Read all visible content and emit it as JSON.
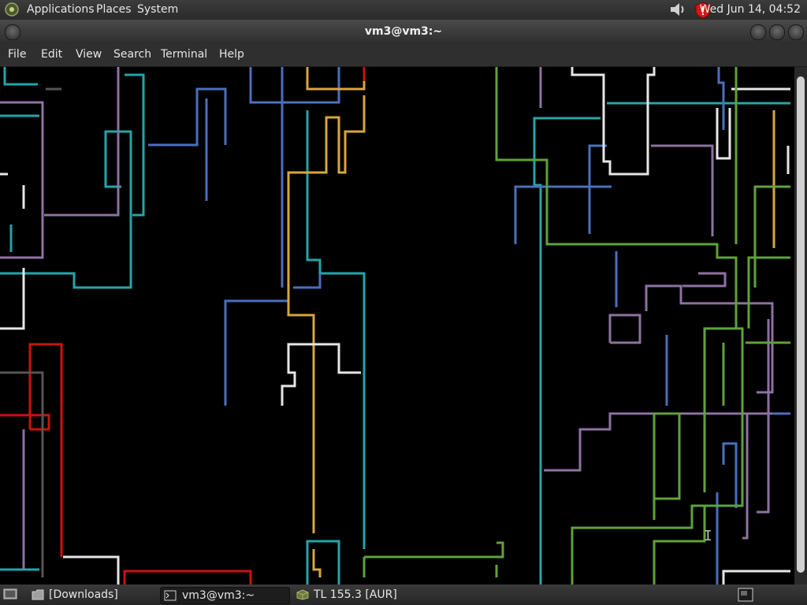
{
  "top_panel": {
    "menus": [
      "Applications",
      "Places",
      "System"
    ],
    "clock": "Wed Jun 14, 04:52"
  },
  "window": {
    "title": "vm3@vm3:~"
  },
  "menubar": [
    "File",
    "Edit",
    "View",
    "Search",
    "Terminal",
    "Help"
  ],
  "taskbar": {
    "items": [
      {
        "label": "[Downloads]",
        "icon": "folder-icon"
      },
      {
        "label": "vm3@vm3:~",
        "icon": "terminal-icon",
        "active": true
      },
      {
        "label": "TL 155.3 [AUR]",
        "icon": "cube-icon"
      }
    ]
  },
  "colors": {
    "cyan": "#23a5a8",
    "purple": "#8d72a0",
    "blue": "#4b6fbd",
    "yellow": "#d8a63c",
    "white": "#e6e6e6",
    "red": "#cc1111",
    "green": "#5fa23a",
    "gray": "#555555"
  }
}
